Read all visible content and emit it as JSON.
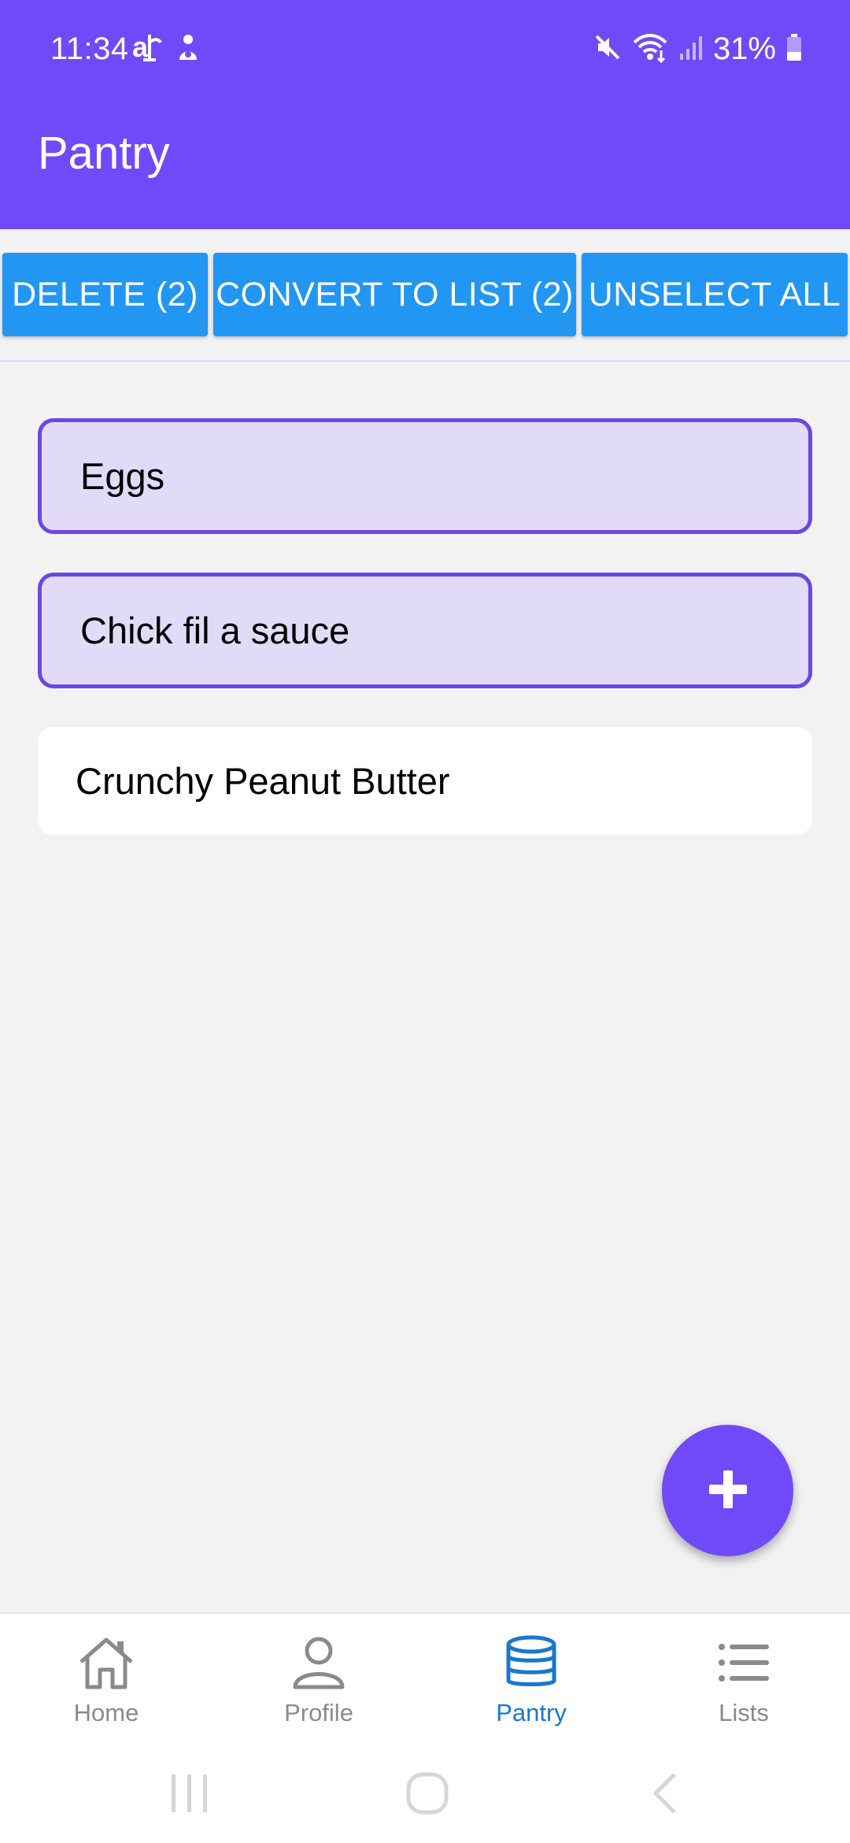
{
  "status_bar": {
    "time": "11:34",
    "battery": "31%",
    "icons": [
      "air-icon",
      "notification-icon",
      "mute-icon",
      "wifi-icon",
      "signal-icon",
      "battery-icon"
    ]
  },
  "app_bar": {
    "title": "Pantry",
    "background": "#704af9"
  },
  "actions": {
    "delete_label": "DELETE (2)",
    "convert_label": "CONVERT TO LIST (2)",
    "unselect_label": "UNSELECT ALL",
    "button_color": "#2196f3"
  },
  "pantry_items": [
    {
      "name": "Eggs",
      "selected": true
    },
    {
      "name": "Chick fil a sauce",
      "selected": true
    },
    {
      "name": "Crunchy Peanut Butter",
      "selected": false
    }
  ],
  "fab": {
    "icon": "plus-icon"
  },
  "bottom_nav": {
    "items": [
      {
        "label": "Home",
        "icon": "home-icon",
        "active": false
      },
      {
        "label": "Profile",
        "icon": "profile-icon",
        "active": false
      },
      {
        "label": "Pantry",
        "icon": "database-icon",
        "active": true
      },
      {
        "label": "Lists",
        "icon": "list-icon",
        "active": false
      }
    ],
    "active_color": "#1976d2",
    "inactive_color": "#8a8a8a"
  },
  "system_nav": {
    "buttons": [
      "recents-icon",
      "home-circle-icon",
      "back-icon"
    ]
  }
}
